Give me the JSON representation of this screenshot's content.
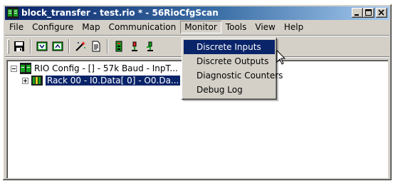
{
  "window": {
    "title": "block_transfer - test.rio * - 56RioCfgScan",
    "app_icon": "rio-config-icon"
  },
  "menubar": {
    "items": [
      "File",
      "Configure",
      "Map",
      "Communication",
      "Monitor",
      "Tools",
      "View",
      "Help"
    ],
    "open_index": 4
  },
  "toolbar": {
    "buttons": [
      "save-icon",
      "download-icon",
      "upload-icon",
      "autoconfig-wand-icon",
      "properties-document-icon",
      "io-module-icon",
      "signal-red-icon",
      "signal-green-icon"
    ]
  },
  "tree": {
    "root_label": "RIO Config - [] -  57k Baud - InpT...",
    "child_label": "Rack 00 - I0.Data[  0] - O0.Da..."
  },
  "monitor_menu": {
    "items": [
      "Discrete Inputs",
      "Discrete Outputs",
      "Diagnostic Counters",
      "Debug Log"
    ],
    "highlighted_index": 0
  },
  "colors": {
    "selection": "#0a246a",
    "face": "#d4d0c8",
    "title_start": "#0a246a",
    "title_end": "#a6caf0"
  }
}
